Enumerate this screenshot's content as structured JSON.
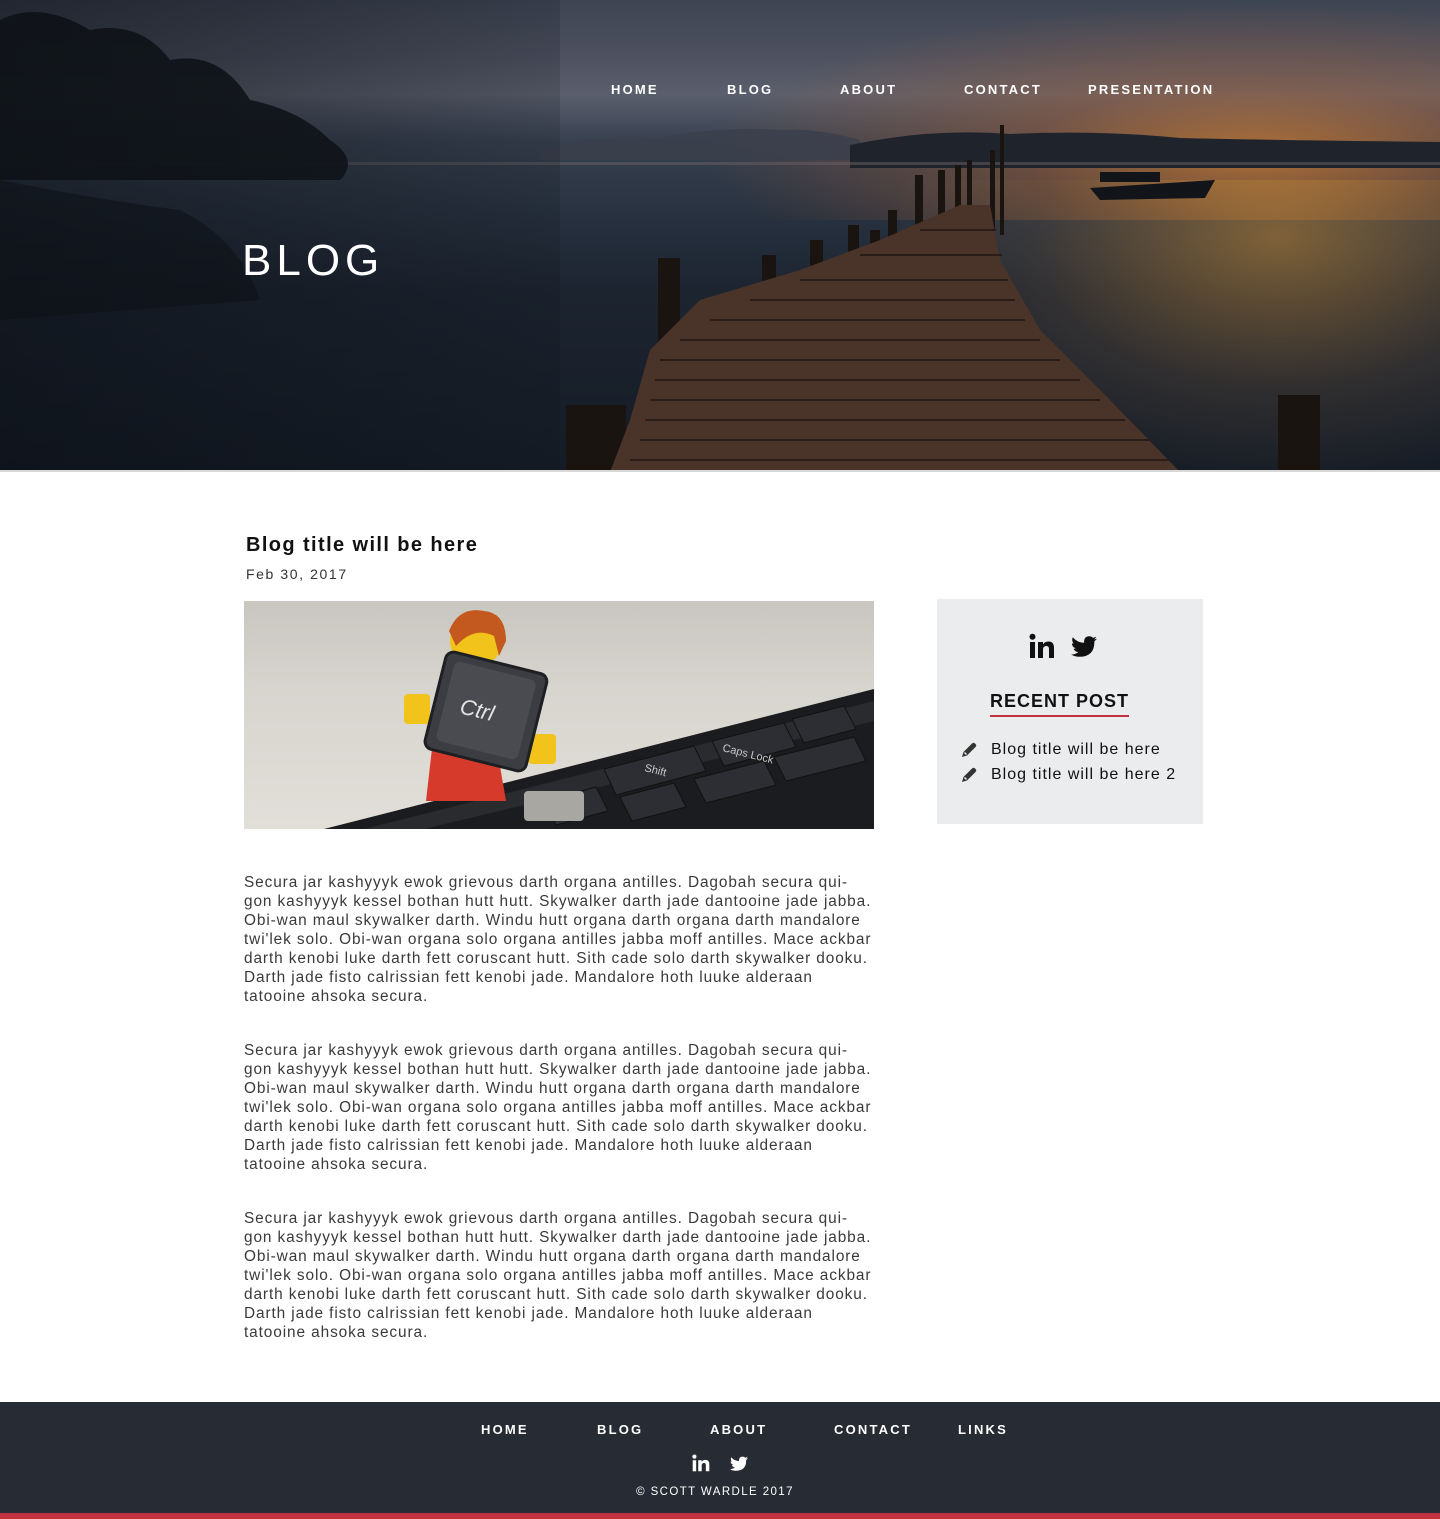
{
  "header": {
    "nav": [
      "HOME",
      "BLOG",
      "ABOUT",
      "CONTACT",
      "PRESENTATION"
    ],
    "title": "BLOG"
  },
  "post": {
    "title": "Blog title will be here",
    "date": "Feb 30, 2017",
    "image_key_label": "Ctrl",
    "image_key_label_2": "Caps Lock",
    "image_key_label_3": "Shift",
    "paragraphs": [
      "Secura jar kashyyyk ewok grievous darth organa antilles. Dagobah secura qui-gon kashyyyk kessel bothan hutt hutt. Skywalker darth jade dantooine jade jabba. Obi-wan maul skywalker darth. Windu hutt organa darth organa darth mandalore twi'lek solo. Obi-wan organa solo organa antilles jabba moff antilles. Mace ackbar darth kenobi luke darth fett coruscant hutt. Sith cade solo darth skywalker dooku. Darth jade fisto calrissian fett kenobi jade. Mandalore hoth luuke alderaan tatooine ahsoka secura.",
      "Secura jar kashyyyk ewok grievous darth organa antilles. Dagobah secura qui-gon kashyyyk kessel bothan hutt hutt. Skywalker darth jade dantooine jade jabba. Obi-wan maul skywalker darth. Windu hutt organa darth organa darth mandalore twi'lek solo. Obi-wan organa solo organa antilles jabba moff antilles. Mace ackbar darth kenobi luke darth fett coruscant hutt. Sith cade solo darth skywalker dooku. Darth jade fisto calrissian fett kenobi jade. Mandalore hoth luuke alderaan tatooine ahsoka secura.",
      "Secura jar kashyyyk ewok grievous darth organa antilles. Dagobah secura qui-gon kashyyyk kessel bothan hutt hutt. Skywalker darth jade dantooine jade jabba. Obi-wan maul skywalker darth. Windu hutt organa darth organa darth mandalore twi'lek solo. Obi-wan organa solo organa antilles jabba moff antilles. Mace ackbar darth kenobi luke darth fett coruscant hutt. Sith cade solo darth skywalker dooku. Darth jade fisto calrissian fett kenobi jade. Mandalore hoth luuke alderaan tatooine ahsoka secura."
    ]
  },
  "sidebar": {
    "social_icons": [
      "linkedin-icon",
      "twitter-icon"
    ],
    "recent_heading": "RECENT POST",
    "recent_posts": [
      "Blog title will be here",
      "Blog title will be here 2"
    ]
  },
  "footer": {
    "nav": [
      "HOME",
      "BLOG",
      "ABOUT",
      "CONTACT",
      "LINKS"
    ],
    "social_icons": [
      "linkedin-icon",
      "twitter-icon"
    ],
    "copyright": "© SCOTT WARDLE 2017"
  },
  "colors": {
    "accent": "#c0323f",
    "footer_bg": "#272b33",
    "sidebar_bg": "#ebecee"
  }
}
